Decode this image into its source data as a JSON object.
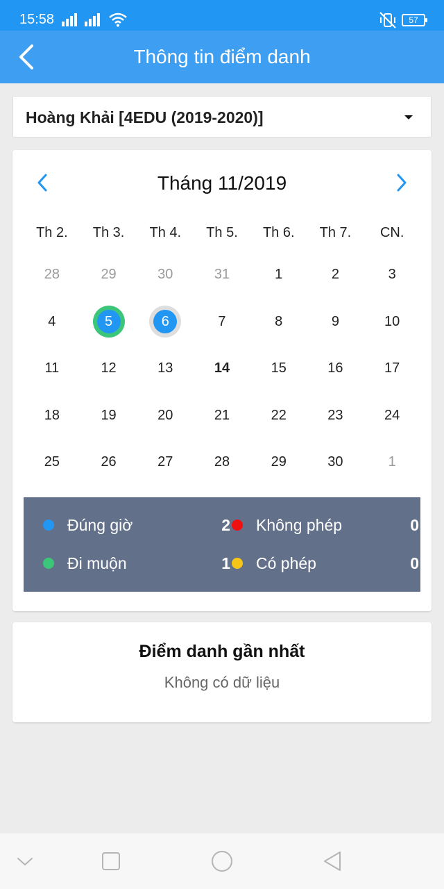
{
  "status_bar": {
    "time": "15:58",
    "battery": "57"
  },
  "app_bar": {
    "title": "Thông tin điểm danh"
  },
  "student_select": {
    "value": "Hoàng Khải [4EDU (2019-2020)]"
  },
  "calendar": {
    "month_title": "Tháng 11/2019",
    "weekdays": [
      "Th 2.",
      "Th 3.",
      "Th 4.",
      "Th 5.",
      "Th 6.",
      "Th 7.",
      "CN."
    ],
    "days": [
      "28",
      "29",
      "30",
      "31",
      "1",
      "2",
      "3",
      "4",
      "5",
      "6",
      "7",
      "8",
      "9",
      "10",
      "11",
      "12",
      "13",
      "14",
      "15",
      "16",
      "17",
      "18",
      "19",
      "20",
      "21",
      "22",
      "23",
      "24",
      "25",
      "26",
      "27",
      "28",
      "29",
      "30",
      "1"
    ]
  },
  "legend": {
    "on_time": {
      "label": "Đúng giờ",
      "count": "2",
      "color": "#2196f3"
    },
    "unexcused": {
      "label": "Không phép",
      "count": "0",
      "color": "#f01010"
    },
    "late": {
      "label": "Đi muộn",
      "count": "1",
      "color": "#3cc67a"
    },
    "excused": {
      "label": "Có phép",
      "count": "0",
      "color": "#f5c518"
    }
  },
  "recent": {
    "title": "Điểm danh gần nhất",
    "empty_text": "Không có dữ liệu"
  },
  "colors": {
    "status_bar": "#2196f3",
    "app_bar": "#3d9ef2",
    "legend_bg": "#637089"
  }
}
